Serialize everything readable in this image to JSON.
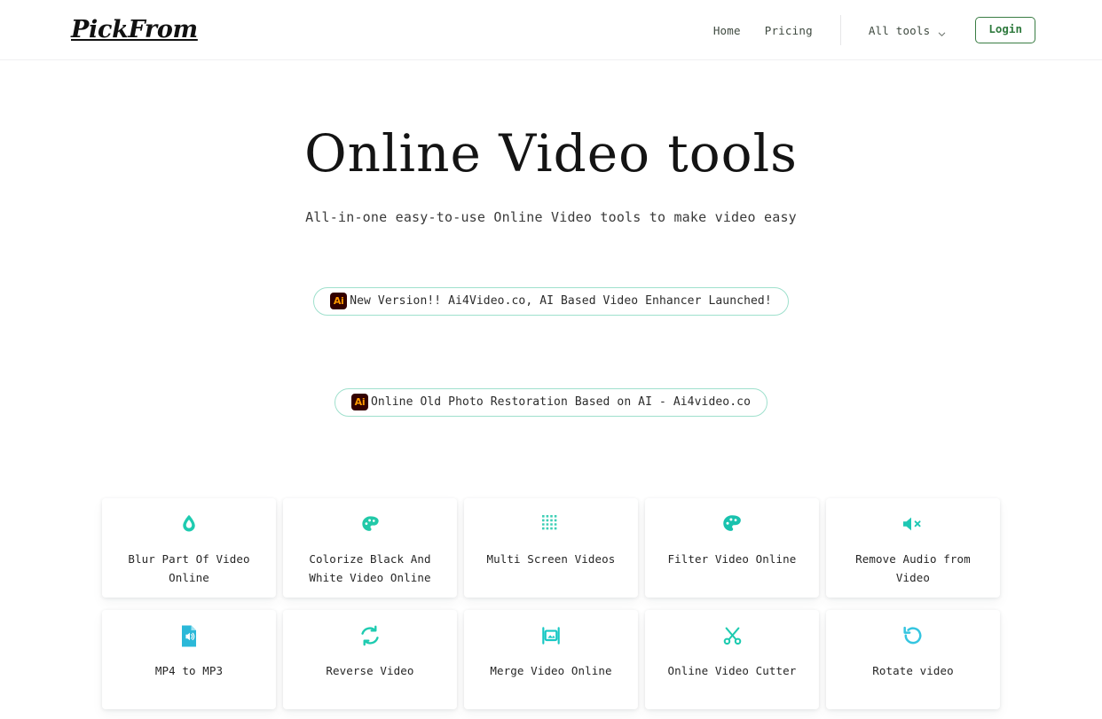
{
  "header": {
    "logo": "PickFrom",
    "nav": {
      "home": "Home",
      "pricing": "Pricing",
      "all_tools": "All tools",
      "login": "Login"
    },
    "colors": {
      "login_green": "#2f7a3e",
      "divider": "#e6e6e8"
    }
  },
  "hero": {
    "title": "Online Video tools",
    "subtitle": "All-in-one easy-to-use Online Video tools to make video easy"
  },
  "banners": [
    {
      "badge": "Ai",
      "text": "New Version!! Ai4Video.co, AI Based Video Enhancer Launched!",
      "badge_bg": "#330000",
      "badge_fg": "#ff9a00",
      "border": "#9fe0cd"
    },
    {
      "badge": "Ai",
      "text": "Online Old Photo Restoration Based on AI - Ai4video.co",
      "badge_bg": "#330000",
      "badge_fg": "#ff9a00",
      "border": "#9fe0cd"
    }
  ],
  "tools": [
    {
      "label": "Blur Part Of Video\nOnline",
      "icon": "water-drop-icon",
      "color": "#1ecbb0"
    },
    {
      "label": "Colorize Black And\nWhite Video Online",
      "icon": "palette-icon",
      "color": "#22c9a8"
    },
    {
      "label": "Multi Screen Videos",
      "icon": "dot-grid-icon",
      "color": "#3ecfb6"
    },
    {
      "label": "Filter Video Online",
      "icon": "palette-icon",
      "color": "#19c2ae"
    },
    {
      "label": "Remove Audio from\nVideo",
      "icon": "speaker-mute-icon",
      "color": "#1ec8b4"
    },
    {
      "label": "MP4 to MP3",
      "icon": "audio-file-icon",
      "color": "#2bb8d8"
    },
    {
      "label": "Reverse Video",
      "icon": "loop-refresh-icon",
      "color": "#1ecbb0"
    },
    {
      "label": "Merge Video Online",
      "icon": "merge-frame-icon",
      "color": "#18c8c4"
    },
    {
      "label": "Online Video Cutter",
      "icon": "scissors-icon",
      "color": "#1ecbb0"
    },
    {
      "label": "Rotate video",
      "icon": "rotate-ccw-icon",
      "color": "#35c5e0"
    }
  ]
}
